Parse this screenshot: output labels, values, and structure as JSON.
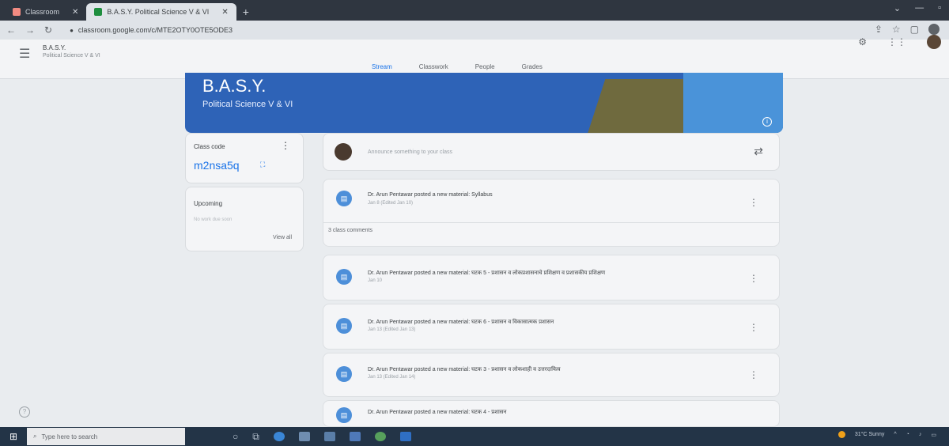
{
  "browser": {
    "tabs": [
      {
        "label": "Classroom",
        "active": false
      },
      {
        "label": "B.A.S.Y. Political Science V & VI",
        "active": true
      }
    ],
    "new_tab": "+",
    "url": "classroom.google.com/c/MTE2OTY0OTE5ODE3"
  },
  "app": {
    "class_name": "B.A.S.Y.",
    "class_subtitle": "Political Science V & VI",
    "nav_tabs": [
      {
        "label": "Stream",
        "active": true
      },
      {
        "label": "Classwork",
        "active": false
      },
      {
        "label": "People",
        "active": false
      },
      {
        "label": "Grades",
        "active": false
      }
    ]
  },
  "banner": {
    "title": "B.A.S.Y.",
    "subtitle": "Political Science V & VI"
  },
  "class_code": {
    "label": "Class code",
    "value": "m2nsa5q"
  },
  "upcoming": {
    "label": "Upcoming",
    "note": "No work due soon",
    "view_all": "View all"
  },
  "announce": {
    "placeholder": "Announce something to your class"
  },
  "posts": [
    {
      "title": "Dr. Arun Pentawar posted a new material: Syllabus",
      "date": "Jan 8 (Edited Jan 10)",
      "comments": "3 class comments"
    },
    {
      "title": "Dr. Arun Pentawar posted a new material: घटक 5 - प्रशासन व लोकप्रशासनाचे प्रशिक्षण व प्रशासकीय प्रशिक्षण",
      "date": "Jan 10"
    },
    {
      "title": "Dr. Arun Pentawar posted a new material: घटक 6 - प्रशासन व विकासात्मक प्रशासन",
      "date": "Jan 13 (Edited Jan 13)"
    },
    {
      "title": "Dr. Arun Pentawar posted a new material: घटक 3 - प्रशासन व लोकशाही व उत्तरदायित्व",
      "date": "Jan 13 (Edited Jan 14)"
    },
    {
      "title": "Dr. Arun Pentawar posted a new material: घटक 4 - प्रशासन",
      "date": ""
    }
  ],
  "taskbar": {
    "search_placeholder": "Type here to search",
    "weather": "31°C Sunny"
  },
  "colors": {
    "accent": "#1a73e8",
    "banner": "#2e63b7",
    "post_icon": "#4d8fd9",
    "taskbar": "#233447"
  }
}
